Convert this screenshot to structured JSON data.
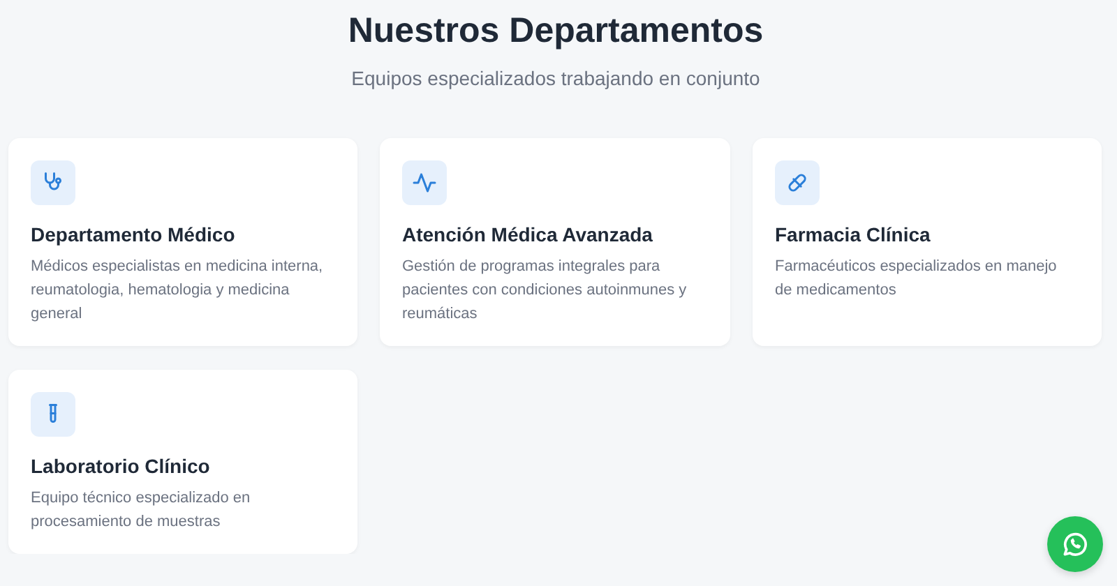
{
  "header": {
    "title": "Nuestros Departamentos",
    "subtitle": "Equipos especializados trabajando en conjunto"
  },
  "departments": [
    {
      "kind": "stethoscope",
      "title": "Departamento Médico",
      "description": "Médicos especialistas en medicina interna, reumatologia, hematologia y medicina general"
    },
    {
      "kind": "activity",
      "title": "Atención Médica Avanzada",
      "description": "Gestión de programas integrales para pacientes con condiciones autoinmunes y reumáticas"
    },
    {
      "kind": "pill",
      "title": "Farmacia Clínica",
      "description": "Farmacéuticos especializados en manejo de medicamentos"
    },
    {
      "kind": "test-tube",
      "title": "Laboratorio Clínico",
      "description": "Equipo técnico especializado en procesamiento de muestras"
    }
  ],
  "chat_button": {
    "kind": "whatsapp"
  }
}
